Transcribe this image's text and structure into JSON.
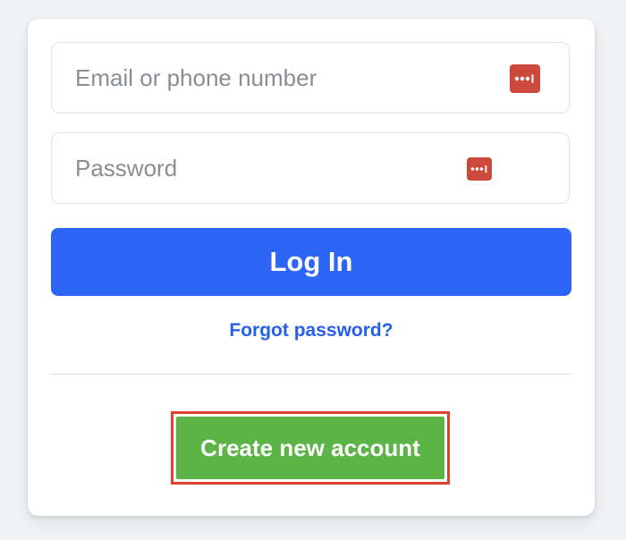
{
  "colors": {
    "background": "#f0f2f5",
    "primary": "#2d66f6",
    "link": "#2461e8",
    "success": "#5bb445",
    "highlight": "#e0432c",
    "password_manager_icon": "#cc4a3d"
  },
  "login_form": {
    "email": {
      "placeholder": "Email or phone number",
      "value": "",
      "icon": "password-manager-icon"
    },
    "password": {
      "placeholder": "Password",
      "value": "",
      "icon": "password-manager-icon"
    },
    "login_label": "Log In",
    "forgot_label": "Forgot password?",
    "create_label": "Create new account"
  }
}
